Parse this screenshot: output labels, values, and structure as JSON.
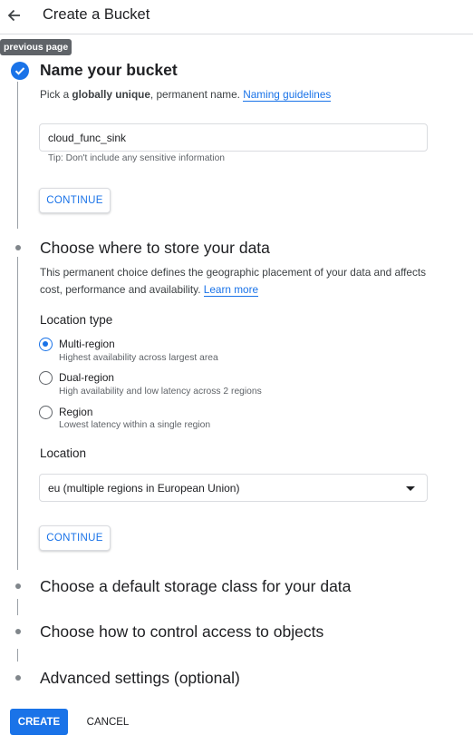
{
  "header": {
    "title": "Create a Bucket",
    "back_icon": "arrow-left-icon",
    "tooltip": "previous page"
  },
  "colors": {
    "accent": "#1a73e8",
    "text": "#202124",
    "muted": "#5f6368",
    "border": "#dadce0"
  },
  "steps": {
    "name": {
      "title": "Name your bucket",
      "status": "completed",
      "desc_before": "Pick a ",
      "desc_bold": "globally unique",
      "desc_after": ", permanent name. ",
      "link": "Naming guidelines",
      "input_value": "cloud_func_sink",
      "tip": "Tip: Don't include any sensitive information",
      "continue_label": "CONTINUE"
    },
    "location": {
      "title": "Choose where to store your data",
      "desc_line1": "This permanent choice defines the geographic placement of your data and affects",
      "desc_line2": "cost, performance and availability. ",
      "link": "Learn more",
      "location_type_label": "Location type",
      "options": [
        {
          "label": "Multi-region",
          "sub": "Highest availability across largest area",
          "selected": true
        },
        {
          "label": "Dual-region",
          "sub": "High availability and low latency across 2 regions",
          "selected": false
        },
        {
          "label": "Region",
          "sub": "Lowest latency within a single region",
          "selected": false
        }
      ],
      "location_label": "Location",
      "location_value": "eu (multiple regions in European Union)",
      "continue_label": "CONTINUE"
    },
    "storage_class": {
      "title": "Choose a default storage class for your data"
    },
    "access": {
      "title": "Choose how to control access to objects"
    },
    "advanced": {
      "title": "Advanced settings (optional)"
    }
  },
  "footer": {
    "create_label": "CREATE",
    "cancel_label": "CANCEL"
  }
}
